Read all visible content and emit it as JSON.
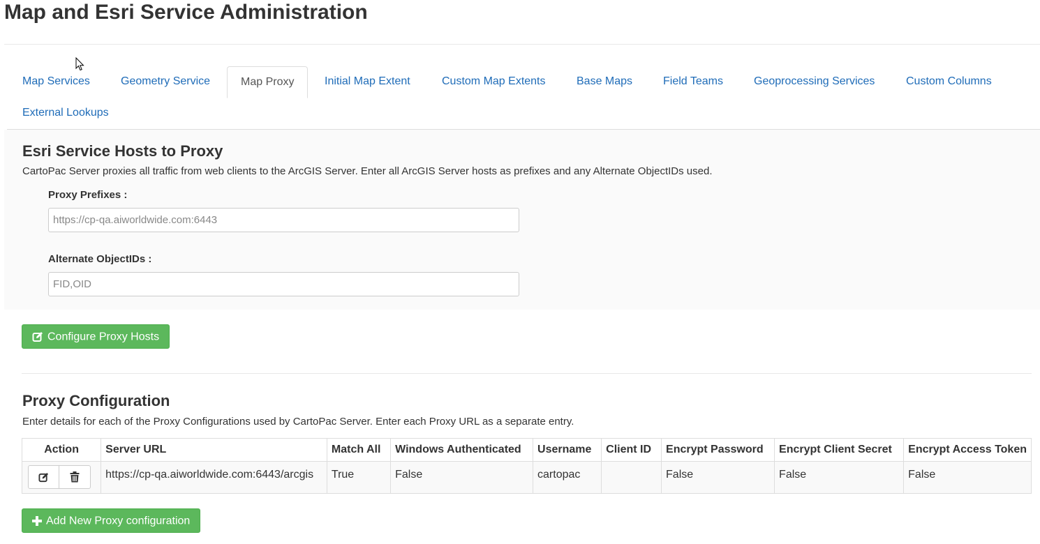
{
  "page": {
    "title": "Map and Esri Service Administration"
  },
  "tabs": [
    {
      "label": "Map Services",
      "active": false
    },
    {
      "label": "Geometry Service",
      "active": false
    },
    {
      "label": "Map Proxy",
      "active": true
    },
    {
      "label": "Initial Map Extent",
      "active": false
    },
    {
      "label": "Custom Map Extents",
      "active": false
    },
    {
      "label": "Base Maps",
      "active": false
    },
    {
      "label": "Field Teams",
      "active": false
    },
    {
      "label": "Geoprocessing Services",
      "active": false
    },
    {
      "label": "Custom Columns",
      "active": false
    },
    {
      "label": "External Lookups",
      "active": false
    }
  ],
  "hosts": {
    "title": "Esri Service Hosts to Proxy",
    "description": "CartoPac Server proxies all traffic from web clients to the ArcGIS Server. Enter all ArcGIS Server hosts as prefixes and any Alternate ObjectIDs used.",
    "prefixes_label": "Proxy Prefixes :",
    "prefixes_placeholder": "https://cp-qa.aiworldwide.com:6443",
    "objectids_label": "Alternate ObjectIDs :",
    "objectids_placeholder": "FID,OID",
    "configure_button": "Configure Proxy Hosts",
    "configure_icon": "edit-icon"
  },
  "proxy_config": {
    "title": "Proxy Configuration",
    "description": "Enter details for each of the Proxy Configurations used by CartoPac Server. Enter each Proxy URL as a separate entry.",
    "columns": [
      "Action",
      "Server URL",
      "Match All",
      "Windows Authenticated",
      "Username",
      "Client ID",
      "Encrypt Password",
      "Encrypt Client Secret",
      "Encrypt Access Token"
    ],
    "rows": [
      {
        "server_url": "https://cp-qa.aiworldwide.com:6443/arcgis",
        "match_all": "True",
        "windows_authenticated": "False",
        "username": "cartopac",
        "client_id": "",
        "encrypt_password": "False",
        "encrypt_client_secret": "False",
        "encrypt_access_token": "False",
        "actions": [
          "edit-icon",
          "trash-icon"
        ]
      }
    ],
    "add_button": "Add New Proxy configuration",
    "add_icon": "plus-icon"
  },
  "colors": {
    "link": "#1f6cb8",
    "success": "#5cb85c",
    "text": "#333333",
    "border": "#dddddd"
  }
}
